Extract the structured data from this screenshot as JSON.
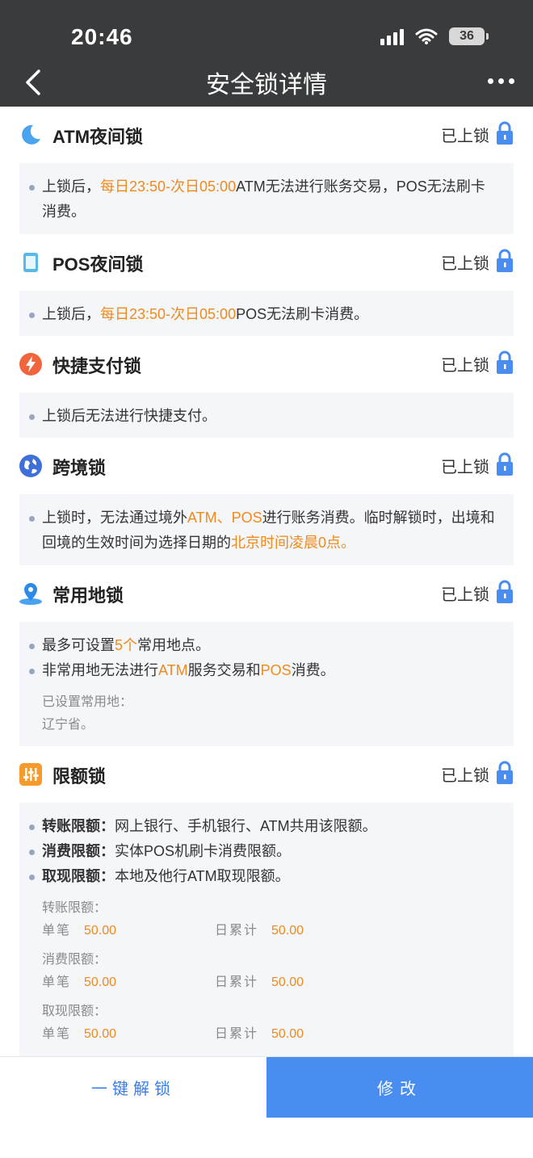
{
  "status_bar": {
    "time": "20:46",
    "battery": "36"
  },
  "nav": {
    "title": "安全锁详情"
  },
  "sections": {
    "atm": {
      "title": "ATM夜间锁",
      "state": "已上锁",
      "l1_a": "上锁后，",
      "l1_hl": "每日23:50-次日05:00",
      "l1_b": "ATM无法进行账务交易，POS无法刷卡消费。"
    },
    "pos": {
      "title": "POS夜间锁",
      "state": "已上锁",
      "l1_a": "上锁后，",
      "l1_hl": "每日23:50-次日05:00",
      "l1_b": "POS无法刷卡消费。"
    },
    "quick": {
      "title": "快捷支付锁",
      "state": "已上锁",
      "l1": "上锁后无法进行快捷支付。"
    },
    "cross": {
      "title": "跨境锁",
      "state": "已上锁",
      "l1_a": "上锁时，无法通过境外",
      "l1_hl1": "ATM、POS",
      "l1_b": "进行账务消费。临时解锁时，出境和回境的生效时间为选择日期的",
      "l1_hl2": "北京时间凌晨0点。"
    },
    "location": {
      "title": "常用地锁",
      "state": "已上锁",
      "l1_a": "最多可设置",
      "l1_hl": "5个",
      "l1_b": "常用地点。",
      "l2_a": "非常用地无法进行",
      "l2_hl1": "ATM",
      "l2_b": "服务交易和",
      "l2_hl2": "POS",
      "l2_c": "消费。",
      "set_label": "已设置常用地：",
      "set_value": "辽宁省。"
    },
    "limit": {
      "title": "限额锁",
      "state": "已上锁",
      "b1_label": "转账限额：",
      "b1_text": "网上银行、手机银行、ATM共用该限额。",
      "b2_label": "消费限额：",
      "b2_text": "实体POS机刷卡消费限额。",
      "b3_label": "取现限额：",
      "b3_text": "本地及他行ATM取现限额。",
      "groups": [
        {
          "name": "转账限额：",
          "single_label": "单笔",
          "single": "50.00",
          "daily_label": "日累计",
          "daily": "50.00"
        },
        {
          "name": "消费限额：",
          "single_label": "单笔",
          "single": "50.00",
          "daily_label": "日累计",
          "daily": "50.00"
        },
        {
          "name": "取现限额：",
          "single_label": "单笔",
          "single": "50.00",
          "daily_label": "日累计",
          "daily": "50.00"
        }
      ]
    }
  },
  "buttons": {
    "unlock": "一键解锁",
    "edit": "修改"
  },
  "colors": {
    "nav_bg": "#3a3b3d",
    "accent": "#4a8df0",
    "highlight": "#f08a1c",
    "panel_bg": "#f4f6fa"
  }
}
